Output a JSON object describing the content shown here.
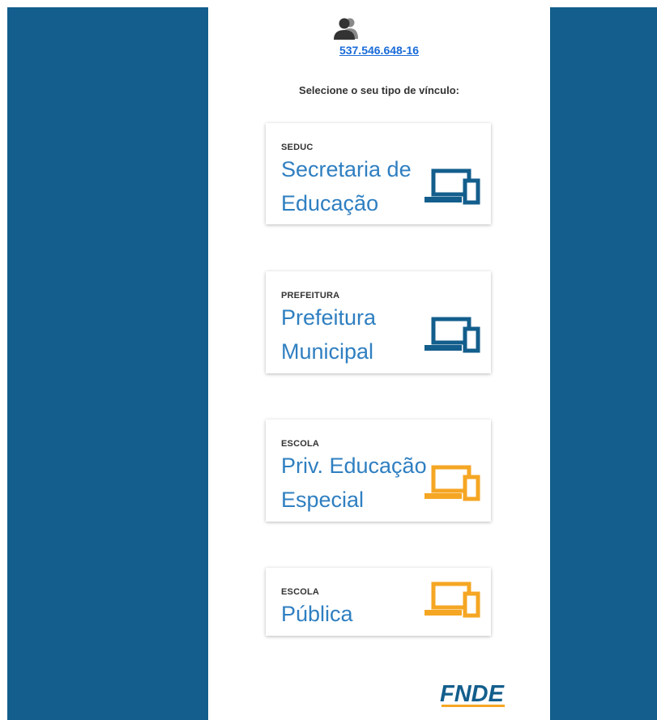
{
  "user": {
    "icon": "users-icon",
    "id": "537.546.648-16"
  },
  "prompt": "Selecione o seu tipo de vínculo:",
  "cards": [
    {
      "tag": "SEDUC",
      "title_line1": "Secretaria de",
      "title_line2": "Educação",
      "icon": "devices-icon",
      "icon_color": "#135e8c"
    },
    {
      "tag": "PREFEITURA",
      "title_line1": "Prefeitura",
      "title_line2": "Municipal",
      "icon": "devices-icon",
      "icon_color": "#135e8c"
    },
    {
      "tag": "ESCOLA",
      "title_line1": "Priv. Educação",
      "title_line2": "Especial",
      "icon": "devices-icon",
      "icon_color": "#f5a623"
    },
    {
      "tag": "ESCOLA",
      "title_line1": "Pública",
      "icon": "devices-icon",
      "icon_color": "#f5a623"
    }
  ],
  "footer": {
    "logo_text": "FNDE",
    "logo_color": "#135e8c",
    "logo_underline_color": "#f5a623"
  },
  "colors": {
    "sidebar": "#135e8c",
    "card_title": "#2f7fc1",
    "link": "#1a6bd8"
  }
}
